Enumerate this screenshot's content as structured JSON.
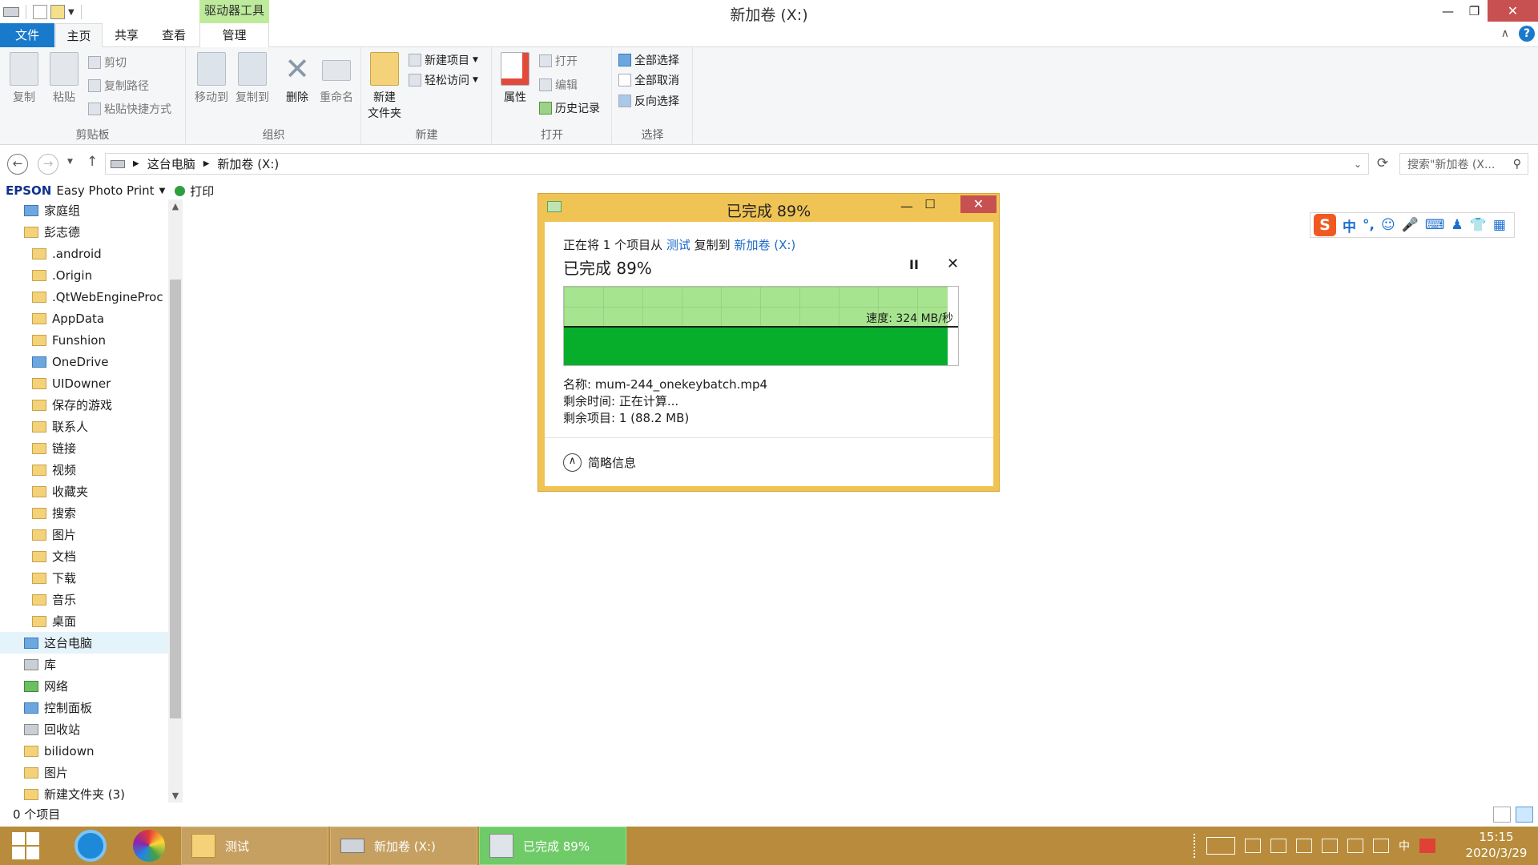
{
  "window": {
    "title": "新加卷 (X:)",
    "context_tool": "驱动器工具"
  },
  "tabs": {
    "file": "文件",
    "home": "主页",
    "share": "共享",
    "view": "查看",
    "manage": "管理"
  },
  "ribbon": {
    "clipboard": {
      "label": "剪贴板",
      "copy": "复制",
      "paste": "粘贴",
      "cut": "剪切",
      "copy_path": "复制路径",
      "paste_shortcut": "粘贴快捷方式"
    },
    "organize": {
      "label": "组织",
      "move_to": "移动到",
      "copy_to": "复制到",
      "delete": "删除",
      "rename": "重命名"
    },
    "new": {
      "label": "新建",
      "new_folder_1": "新建",
      "new_folder_2": "文件夹",
      "new_item": "新建项目",
      "easy_access": "轻松访问"
    },
    "open": {
      "label": "打开",
      "properties": "属性",
      "open": "打开",
      "edit": "编辑",
      "history": "历史记录"
    },
    "select": {
      "label": "选择",
      "select_all": "全部选择",
      "select_none": "全部取消",
      "invert": "反向选择"
    }
  },
  "address": {
    "root": "这台电脑",
    "current": "新加卷 (X:)",
    "search_placeholder": "搜索\"新加卷 (X..."
  },
  "epson": {
    "brand": "EPSON",
    "app": "Easy Photo Print",
    "print": "打印"
  },
  "nav": {
    "items": [
      {
        "label": "家庭组",
        "level": 1,
        "icon": "homegroup-icon"
      },
      {
        "label": "彭志德",
        "level": 1,
        "icon": "user-folder-icon"
      },
      {
        "label": ".android",
        "level": 2,
        "icon": "folder-icon"
      },
      {
        "label": ".Origin",
        "level": 2,
        "icon": "folder-icon"
      },
      {
        "label": ".QtWebEngineProc",
        "level": 2,
        "icon": "folder-icon"
      },
      {
        "label": "AppData",
        "level": 2,
        "icon": "folder-icon"
      },
      {
        "label": "Funshion",
        "level": 2,
        "icon": "folder-icon"
      },
      {
        "label": "OneDrive",
        "level": 2,
        "icon": "onedrive-icon"
      },
      {
        "label": "UIDowner",
        "level": 2,
        "icon": "folder-icon"
      },
      {
        "label": "保存的游戏",
        "level": 2,
        "icon": "games-folder-icon"
      },
      {
        "label": "联系人",
        "level": 2,
        "icon": "contacts-icon"
      },
      {
        "label": "链接",
        "level": 2,
        "icon": "links-icon"
      },
      {
        "label": "视频",
        "level": 2,
        "icon": "videos-icon"
      },
      {
        "label": "收藏夹",
        "level": 2,
        "icon": "favorites-icon"
      },
      {
        "label": "搜索",
        "level": 2,
        "icon": "search-folder-icon"
      },
      {
        "label": "图片",
        "level": 2,
        "icon": "pictures-icon"
      },
      {
        "label": "文档",
        "level": 2,
        "icon": "documents-icon"
      },
      {
        "label": "下载",
        "level": 2,
        "icon": "downloads-icon"
      },
      {
        "label": "音乐",
        "level": 2,
        "icon": "music-icon"
      },
      {
        "label": "桌面",
        "level": 2,
        "icon": "desktop-icon"
      },
      {
        "label": "这台电脑",
        "level": 1,
        "icon": "this-pc-icon",
        "selected": true
      },
      {
        "label": "库",
        "level": 1,
        "icon": "libraries-icon"
      },
      {
        "label": "网络",
        "level": 1,
        "icon": "network-icon"
      },
      {
        "label": "控制面板",
        "level": 1,
        "icon": "control-panel-icon"
      },
      {
        "label": "回收站",
        "level": 1,
        "icon": "recycle-bin-icon"
      },
      {
        "label": "bilidown",
        "level": 1,
        "icon": "folder-icon"
      },
      {
        "label": "图片",
        "level": 1,
        "icon": "folder-icon"
      },
      {
        "label": "新建文件夹 (3)",
        "level": 1,
        "icon": "folder-icon"
      }
    ]
  },
  "status": {
    "items": "0 个项目"
  },
  "ime": {
    "lang": "中",
    "punct": "°,"
  },
  "dialog": {
    "title": "已完成 89%",
    "copying_prefix": "正在将 1 个项目从",
    "source": "测试",
    "copy_to_word": "复制到",
    "dest": "新加卷 (X:)",
    "percent_text": "已完成 89%",
    "progress": 0.89,
    "speed": "速度: 324 MB/秒",
    "name": "名称: mum-244_onekeybatch.mp4",
    "time_left": "剩余时间: 正在计算...",
    "items_left": "剩余项目: 1 (88.2 MB)",
    "less_details": "简略信息",
    "pause_glyph": "II",
    "cancel_glyph": "✕"
  },
  "taskbar": {
    "tasks": [
      {
        "label": "测试"
      },
      {
        "label": "新加卷 (X:)"
      },
      {
        "label": "已完成 89%",
        "active": true
      }
    ],
    "ime_tray": "中",
    "time": "15:15",
    "date": "2020/3/29"
  },
  "colors": {
    "accent": "#1979ca",
    "taskbar": "#b88c3c",
    "dialog_frame": "#f0c454",
    "progress_green": "#06ae2b"
  }
}
